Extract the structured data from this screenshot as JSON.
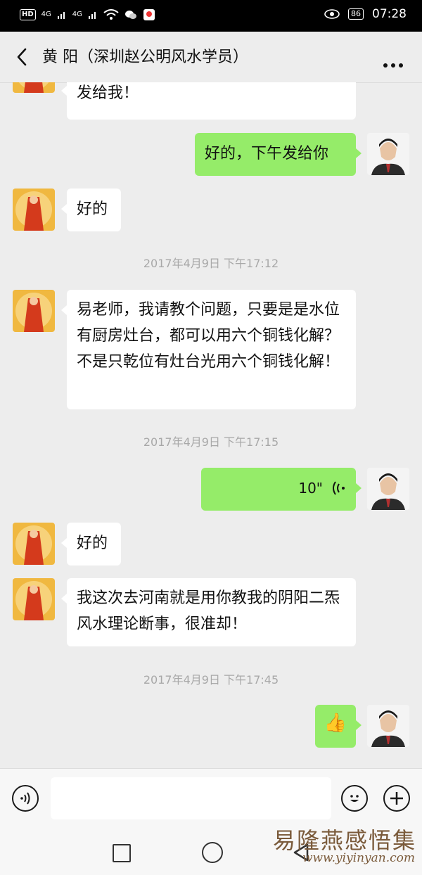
{
  "status_bar": {
    "hd": "HD",
    "sig1": "4G",
    "sig2": "4G",
    "battery": "86",
    "time": "07:28"
  },
  "header": {
    "title": "黄   阳（深圳赵公明风水学员）"
  },
  "messages": {
    "m1": "发给我！",
    "m2": "好的，下午发给你",
    "m3": "好的",
    "ts1": "2017年4月9日 下午17:12",
    "m4": "易老师，我请教个问题，只要是是水位有厨房灶台，都可以用六个铜钱化解？不是只乾位有灶台光用六个铜钱化解！",
    "ts2": "2017年4月9日 下午17:15",
    "voice_duration": "10\"",
    "m6": "好的",
    "m7": "我这次去河南就是用你教我的阴阳二炁风水理论断事，很准却！",
    "ts3": "2017年4月9日 下午17:45",
    "thumbs": "👍"
  },
  "watermark": {
    "title": "易隆燕感悟集",
    "url": "www.yiyinyan.com"
  },
  "colors": {
    "bubble_green": "#95ec69",
    "bubble_white": "#ffffff",
    "chat_bg": "#ededed"
  }
}
